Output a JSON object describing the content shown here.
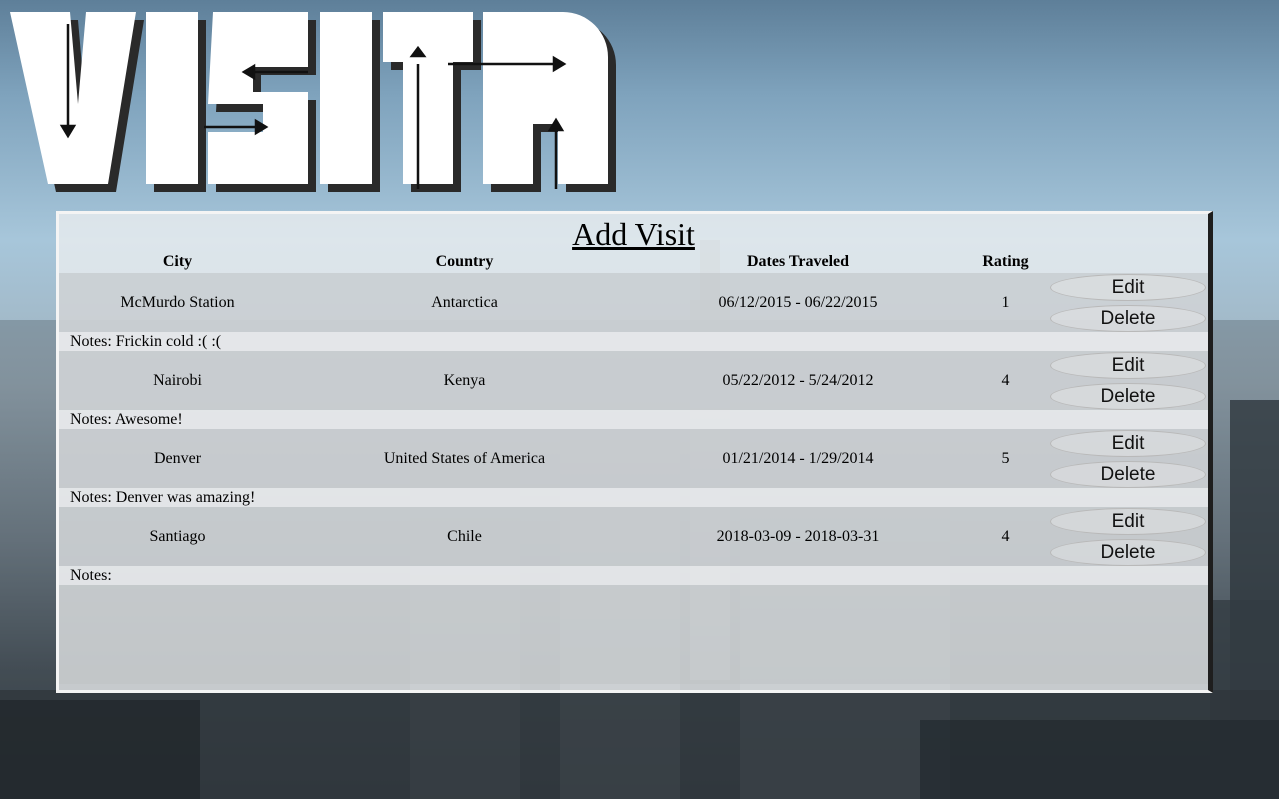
{
  "app": {
    "logo_text": "VISITR"
  },
  "panel": {
    "add_visit_label": "Add Visit"
  },
  "table": {
    "headers": {
      "city": "City",
      "country": "Country",
      "dates": "Dates Traveled",
      "rating": "Rating"
    },
    "edit_label": "Edit",
    "delete_label": "Delete",
    "notes_prefix": "Notes:",
    "rows": [
      {
        "city": "McMurdo Station",
        "country": "Antarctica",
        "dates": "06/12/2015 - 06/22/2015",
        "rating": "1",
        "notes": "Notes: Frickin cold :( :("
      },
      {
        "city": "Nairobi",
        "country": "Kenya",
        "dates": "05/22/2012 - 5/24/2012",
        "rating": "4",
        "notes": "Notes: Awesome!"
      },
      {
        "city": "Denver",
        "country": "United States of America",
        "dates": "01/21/2014 - 1/29/2014",
        "rating": "5",
        "notes": "Notes: Denver was amazing!"
      },
      {
        "city": "Santiago",
        "country": "Chile",
        "dates": "2018-03-09 - 2018-03-31",
        "rating": "4",
        "notes": "Notes:"
      }
    ]
  }
}
